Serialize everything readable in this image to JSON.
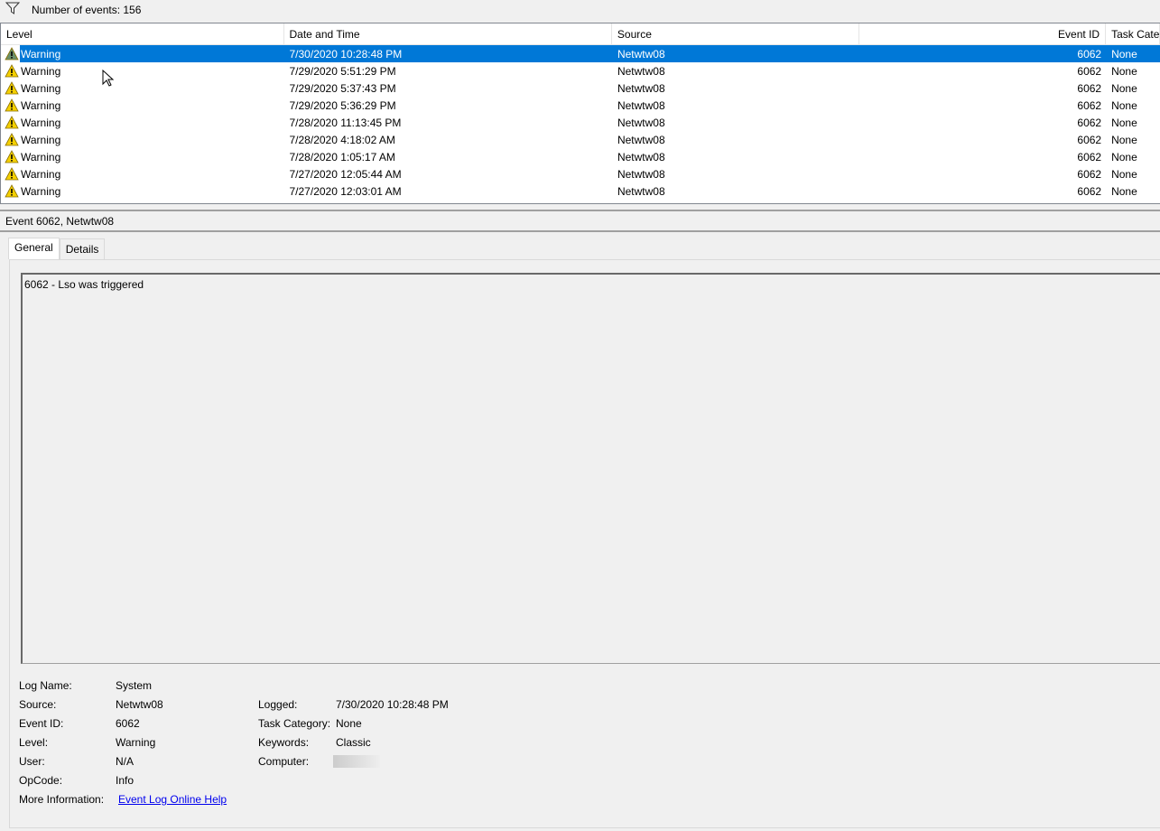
{
  "toolbar": {
    "event_count": "Number of events: 156"
  },
  "columns": [
    "Level",
    "Date and Time",
    "Source",
    "Event ID",
    "Task Categ"
  ],
  "rows": [
    {
      "level": "Warning",
      "datetime": "7/30/2020 10:28:48 PM",
      "source": "Netwtw08",
      "event_id": "6062",
      "task": "None"
    },
    {
      "level": "Warning",
      "datetime": "7/29/2020 5:51:29 PM",
      "source": "Netwtw08",
      "event_id": "6062",
      "task": "None"
    },
    {
      "level": "Warning",
      "datetime": "7/29/2020 5:37:43 PM",
      "source": "Netwtw08",
      "event_id": "6062",
      "task": "None"
    },
    {
      "level": "Warning",
      "datetime": "7/29/2020 5:36:29 PM",
      "source": "Netwtw08",
      "event_id": "6062",
      "task": "None"
    },
    {
      "level": "Warning",
      "datetime": "7/28/2020 11:13:45 PM",
      "source": "Netwtw08",
      "event_id": "6062",
      "task": "None"
    },
    {
      "level": "Warning",
      "datetime": "7/28/2020 4:18:02 AM",
      "source": "Netwtw08",
      "event_id": "6062",
      "task": "None"
    },
    {
      "level": "Warning",
      "datetime": "7/28/2020 1:05:17 AM",
      "source": "Netwtw08",
      "event_id": "6062",
      "task": "None"
    },
    {
      "level": "Warning",
      "datetime": "7/27/2020 12:05:44 AM",
      "source": "Netwtw08",
      "event_id": "6062",
      "task": "None"
    },
    {
      "level": "Warning",
      "datetime": "7/27/2020 12:03:01 AM",
      "source": "Netwtw08",
      "event_id": "6062",
      "task": "None"
    }
  ],
  "detail": {
    "title": "Event 6062, Netwtw08",
    "tabs": [
      "General",
      "Details"
    ],
    "description": "6062 - Lso was triggered",
    "labels": {
      "log_name": "Log Name:",
      "source": "Source:",
      "event_id": "Event ID:",
      "level": "Level:",
      "user": "User:",
      "opcode": "OpCode:",
      "more_info": "More Information:",
      "logged": "Logged:",
      "task_category": "Task Category:",
      "keywords": "Keywords:",
      "computer": "Computer:"
    },
    "values": {
      "log_name": "System",
      "source": "Netwtw08",
      "event_id": "6062",
      "level": "Warning",
      "user": "N/A",
      "opcode": "Info",
      "more_info": "Event Log Online Help",
      "logged": "7/30/2020 10:28:48 PM",
      "task_category": "None",
      "keywords": "Classic"
    }
  }
}
